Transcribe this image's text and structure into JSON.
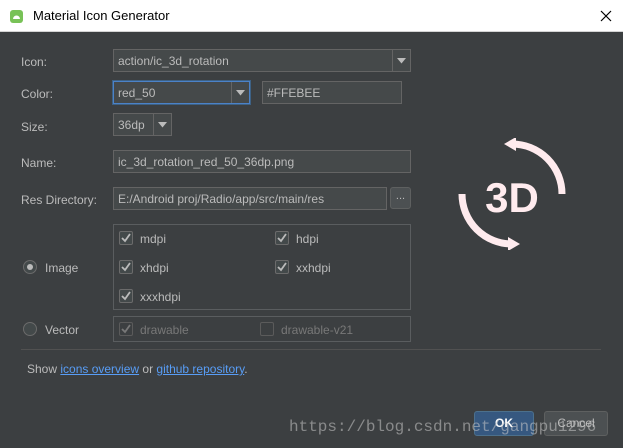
{
  "window": {
    "title": "Material Icon Generator",
    "title_icon": "android-icon",
    "close_icon": "close-icon"
  },
  "form": {
    "icon": {
      "label": "Icon:",
      "value": "action/ic_3d_rotation"
    },
    "color": {
      "label": "Color:",
      "value": "red_50",
      "hex": "#FFEBEE"
    },
    "size": {
      "label": "Size:",
      "value": "36dp"
    },
    "name": {
      "label": "Name:",
      "value": "ic_3d_rotation_red_50_36dp.png"
    },
    "res_directory": {
      "label": "Res Directory:",
      "value": "E:/Android proj/Radio/app/src/main/res",
      "browse": "..."
    }
  },
  "image": {
    "label": "Image",
    "selected": true,
    "densities": [
      {
        "label": "mdpi",
        "checked": true
      },
      {
        "label": "hdpi",
        "checked": true
      },
      {
        "label": "xhdpi",
        "checked": true
      },
      {
        "label": "xxhdpi",
        "checked": true
      },
      {
        "label": "xxxhdpi",
        "checked": true
      }
    ]
  },
  "vector": {
    "label": "Vector",
    "selected": false,
    "options": [
      {
        "label": "drawable",
        "checked": true
      },
      {
        "label": "drawable-v21",
        "checked": false
      }
    ]
  },
  "preview": {
    "icon": "3d-rotation-icon",
    "color": "#FFEBEE",
    "text": "3D"
  },
  "footer": {
    "prefix": "Show ",
    "link1": "icons overview",
    "middle": " or ",
    "link2": "github repository",
    "suffix": "."
  },
  "buttons": {
    "ok": "OK",
    "cancel": "Cancel"
  },
  "watermark": "https://blog.csdn.net/gangpu1296",
  "colors": {
    "background": "#3c3f41",
    "link": "#589df6",
    "accent": "#365880"
  }
}
